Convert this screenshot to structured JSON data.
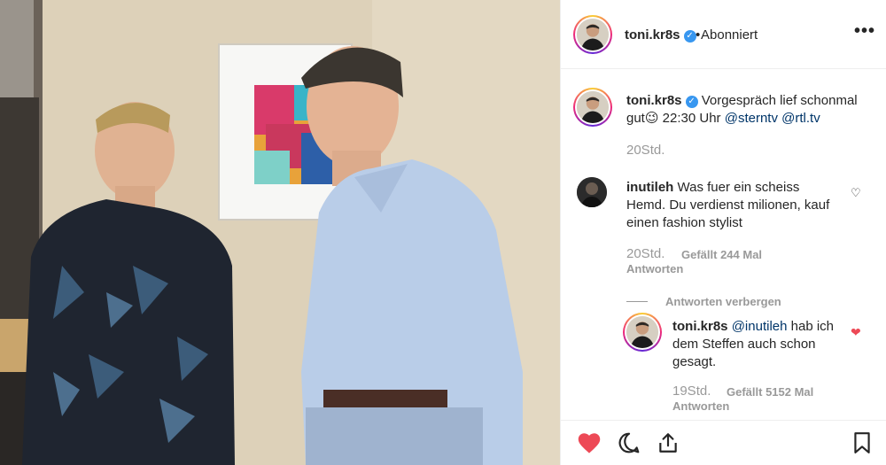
{
  "post": {
    "username": "toni.kr8s",
    "follow_status": "Abonniert",
    "dot": "•",
    "more_icon": "more-options-icon",
    "more_text": "•••"
  },
  "caption": {
    "username": "toni.kr8s",
    "text_before": "Vorgespräch lief schonmal gut",
    "emoji": "😉",
    "time_text": " 22:30 Uhr ",
    "mention1": "@sterntv",
    "mention2": "@rtl.tv",
    "time": "20Std."
  },
  "comments": [
    {
      "username": "inutileh",
      "text": "Was fuer ein scheiss Hemd. Du verdienst milionen, kauf einen fashion stylist",
      "time": "20Std.",
      "likes": "Gefällt 244 Mal",
      "reply": "Antworten",
      "hide_replies": "Antworten verbergen",
      "replies": [
        {
          "username": "toni.kr8s",
          "mention": "@inutileh",
          "text": "hab ich dem Steffen auch schon gesagt.",
          "time": "19Std.",
          "likes": "Gefällt 5152 Mal",
          "reply": "Antworten",
          "liked": true
        }
      ]
    }
  ],
  "actions": {
    "like_icon": "heart-filled-icon",
    "comment_icon": "comment-icon",
    "share_icon": "share-icon",
    "save_icon": "bookmark-icon"
  },
  "colors": {
    "verified": "#3897f0",
    "liked": "#ed4956",
    "link": "#003569",
    "muted": "#999999"
  }
}
